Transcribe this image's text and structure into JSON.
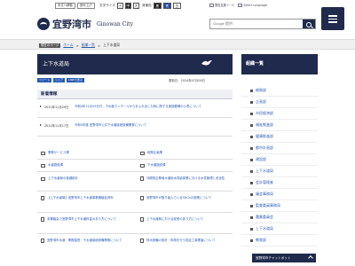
{
  "util": {
    "buttons": [
      "本文へ移動",
      "読み上げ"
    ],
    "font_label": "文字サイズ",
    "font_sizes": [
      "小",
      "中",
      "大"
    ],
    "bg_label": "背景色",
    "bg_colors": [
      {
        "label": "黒",
        "bg": "#222222",
        "fg": "#ffffff"
      },
      {
        "label": "青",
        "bg": "#1f4aa8",
        "fg": "#ffffff"
      },
      {
        "label": "白",
        "bg": "#ffffff",
        "fg": "#222222"
      }
    ],
    "links": [
      "閲覧支援ツール",
      "Select Language"
    ]
  },
  "logo": {
    "ja": "宜野湾市",
    "en": "Ginowan City"
  },
  "search": {
    "placeholder": "Google 提供"
  },
  "breadcrumb": {
    "current_label": "現在のページ",
    "items": [
      "ホーム",
      "組織一覧",
      "上下水道局"
    ]
  },
  "title": "上下水道局",
  "tools": [
    "ツイート",
    "シェア",
    "LINEで送る"
  ],
  "updated": "更新日：2024年07月08日",
  "news": {
    "heading": "新着情報",
    "items": [
      {
        "date": "2022年11月29日",
        "text": "令和4年11月29日付…下水道マンホールからあふれ出した時に関する実施要綱の公表について"
      },
      {
        "date": "2022年11月17日",
        "text": "令和5年度 宜野湾市公共下水道接続設備業務について"
      }
    ]
  },
  "grid": [
    [
      "業務サービス課",
      "総務企画課"
    ],
    [
      "水道施設課",
      "下水道施設課"
    ],
    [
      "上下水道局の各種統計",
      "沖縄県企業局水道用水供給事業における水質管理と安全性"
    ],
    [
      "【上下水道局】宜野湾市上下水道事業審議会資料",
      "宜野湾市が取り組んでいるSDGsの施策について"
    ],
    [
      "本審議会で宜野湾市上下水道料金のあり方について",
      "上下水道局における経営のあり方について"
    ],
    [
      "宜野湾市水道・業務運営・下水道接続設備業務について",
      "排水設備の設計・申請を行う指定工事業者について"
    ]
  ],
  "sidebar": {
    "heading": "組織一覧",
    "items": [
      "総務部",
      "企画部",
      "市民経済部",
      "福祉推進部",
      "健康推進部",
      "都市計画部",
      "建設部",
      "上下水道局",
      "会計管理者",
      "議会事務局",
      "監査委員事務局",
      "農業委員会",
      "上下水道局",
      "教育部"
    ]
  },
  "chatbot": "宜野湾市チャットボット"
}
